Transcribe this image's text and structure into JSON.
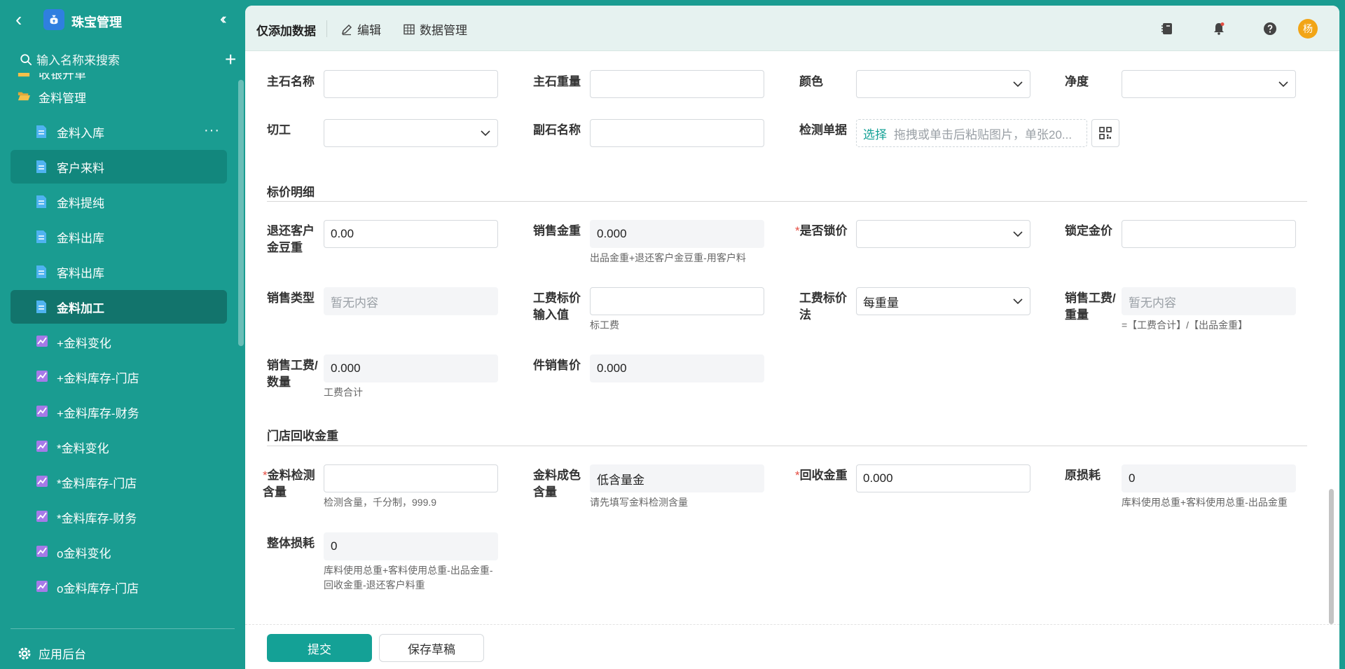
{
  "app": {
    "title": "珠宝管理"
  },
  "sidebar": {
    "search_placeholder": "输入名称来搜索",
    "items": [
      {
        "label": "收银开单",
        "type": "folder"
      },
      {
        "label": "金料管理",
        "type": "folder"
      },
      {
        "label": "金料入库",
        "type": "doc"
      },
      {
        "label": "客户来料",
        "type": "doc"
      },
      {
        "label": "金料提纯",
        "type": "doc"
      },
      {
        "label": "金料出库",
        "type": "doc"
      },
      {
        "label": "客料出库",
        "type": "doc"
      },
      {
        "label": "金料加工",
        "type": "doc"
      },
      {
        "label": "+金料变化",
        "type": "chart"
      },
      {
        "label": "+金料库存-门店",
        "type": "chart"
      },
      {
        "label": "+金料库存-财务",
        "type": "chart"
      },
      {
        "label": "*金料变化",
        "type": "chart"
      },
      {
        "label": "*金料库存-门店",
        "type": "chart"
      },
      {
        "label": "*金料库存-财务",
        "type": "chart"
      },
      {
        "label": "o金料变化",
        "type": "chart"
      },
      {
        "label": "o金料库存-门店",
        "type": "chart"
      }
    ],
    "footer_label": "应用后台"
  },
  "topbar": {
    "title": "仅添加数据",
    "edit_label": "编辑",
    "data_manage_label": "数据管理",
    "avatar_text": "杨"
  },
  "form": {
    "row1": {
      "main_stone_name": {
        "label": "主石名称",
        "value": ""
      },
      "main_stone_weight": {
        "label": "主石重量",
        "value": ""
      },
      "color": {
        "label": "颜色",
        "value": ""
      },
      "clarity": {
        "label": "净度",
        "value": ""
      }
    },
    "row2": {
      "cut": {
        "label": "切工",
        "value": ""
      },
      "side_stone_name": {
        "label": "副石名称",
        "value": ""
      },
      "test_doc": {
        "label": "检测单据",
        "pick": "选择",
        "tip": "拖拽或单击后粘贴图片，单张20..."
      }
    },
    "section_pricing": "标价明细",
    "row3": {
      "return_gold_bean": {
        "label": "退还客户金豆重",
        "value": "0.00"
      },
      "sale_gold_weight": {
        "label": "销售金重",
        "value": "0.000",
        "hint": "出品金重+退还客户金豆重-用客户料"
      },
      "lock_price": {
        "label": "是否锁价",
        "value": ""
      },
      "locked_gold_price": {
        "label": "锁定金价",
        "value": ""
      }
    },
    "row4": {
      "sale_type": {
        "label": "销售类型",
        "value": "暂无内容"
      },
      "labor_input": {
        "label": "工费标价输入值",
        "value": "",
        "hint": "标工费"
      },
      "labor_method": {
        "label": "工费标价法",
        "value": "每重量"
      },
      "labor_per_weight": {
        "label": "销售工费/重量",
        "value": "暂无内容",
        "hint": "=【工费合计】/【出品金重】"
      }
    },
    "row5": {
      "labor_per_qty": {
        "label": "销售工费/数量",
        "value": "0.000",
        "hint": "工费合计"
      },
      "unit_price": {
        "label": "件销售价",
        "value": "0.000"
      }
    },
    "section_recycle": "门店回收金重",
    "row6": {
      "gold_test_content": {
        "label": "金料检测含量",
        "value": "",
        "hint": "检测含量，千分制，999.9"
      },
      "gold_fineness": {
        "label": "金料成色含量",
        "value": "低含量金",
        "hint": "请先填写金料检测含量"
      },
      "recycle_weight": {
        "label": "回收金重",
        "value": "0.000"
      },
      "original_loss": {
        "label": "原损耗",
        "value": "0",
        "hint": "库料使用总重+客料使用总重-出品金重"
      }
    },
    "row7": {
      "overall_loss": {
        "label": "整体损耗",
        "value": "0",
        "hint": "库料使用总重+客料使用总重-出品金重-回收金重-退还客户料重"
      }
    }
  },
  "buttons": {
    "submit": "提交",
    "save_draft": "保存草稿"
  },
  "colors": {
    "brand": "#1a9c91",
    "primary": "#14a196",
    "required": "#e54d42"
  }
}
